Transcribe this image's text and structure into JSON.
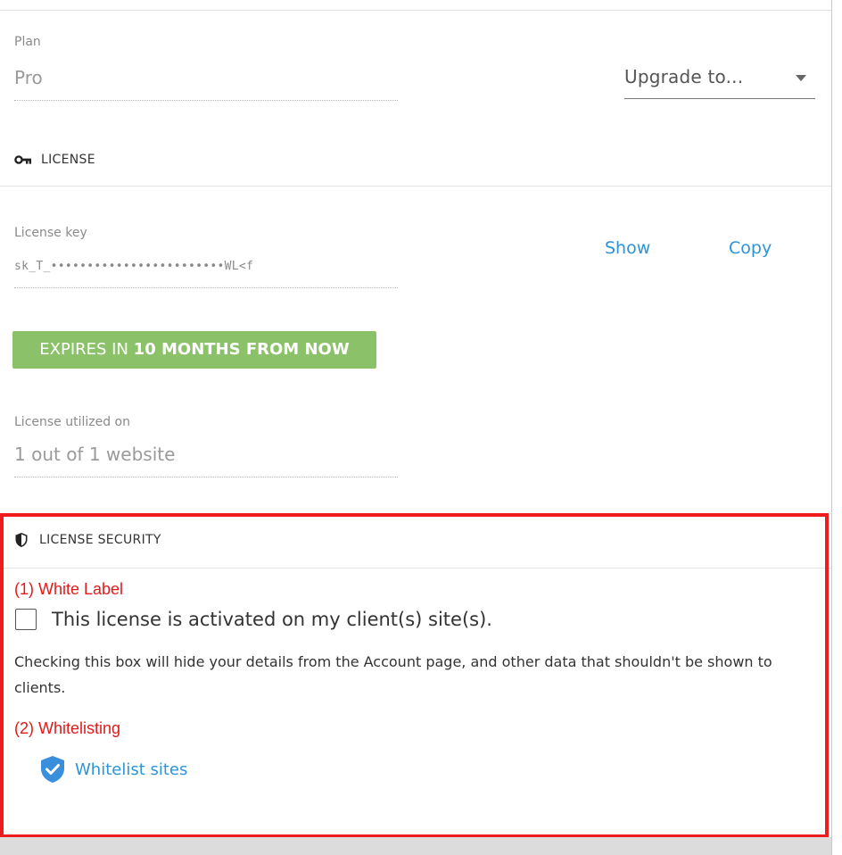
{
  "plan": {
    "label": "Plan",
    "value": "Pro",
    "upgrade_select": "Upgrade to..."
  },
  "license_section": {
    "icon": "key-icon",
    "title": "LICENSE",
    "key_label": "License key",
    "key_value": "sk_T_••••••••••••••••••••••••WL<f",
    "show_link": "Show",
    "copy_link": "Copy",
    "expires_prefix": "EXPIRES IN ",
    "expires_bold": "10 MONTHS FROM NOW",
    "utilized_label": "License utilized on",
    "utilized_value": "1 out of 1 website"
  },
  "security_section": {
    "icon": "shield-icon",
    "title": "LICENSE SECURITY",
    "white_label_heading": "(1) White Label",
    "checkbox_label": "This license is activated on my client(s) site(s).",
    "checkbox_checked": false,
    "description": "Checking this box will hide your details from the Account page, and other data that shouldn't be shown to clients.",
    "whitelisting_heading": "(2) Whitelisting",
    "whitelist_link": "Whitelist sites",
    "whitelist_icon": "shield-check-icon"
  },
  "colors": {
    "link": "#2c94d8",
    "badge": "#8bc269",
    "annotation_red": "#e11b1b"
  }
}
